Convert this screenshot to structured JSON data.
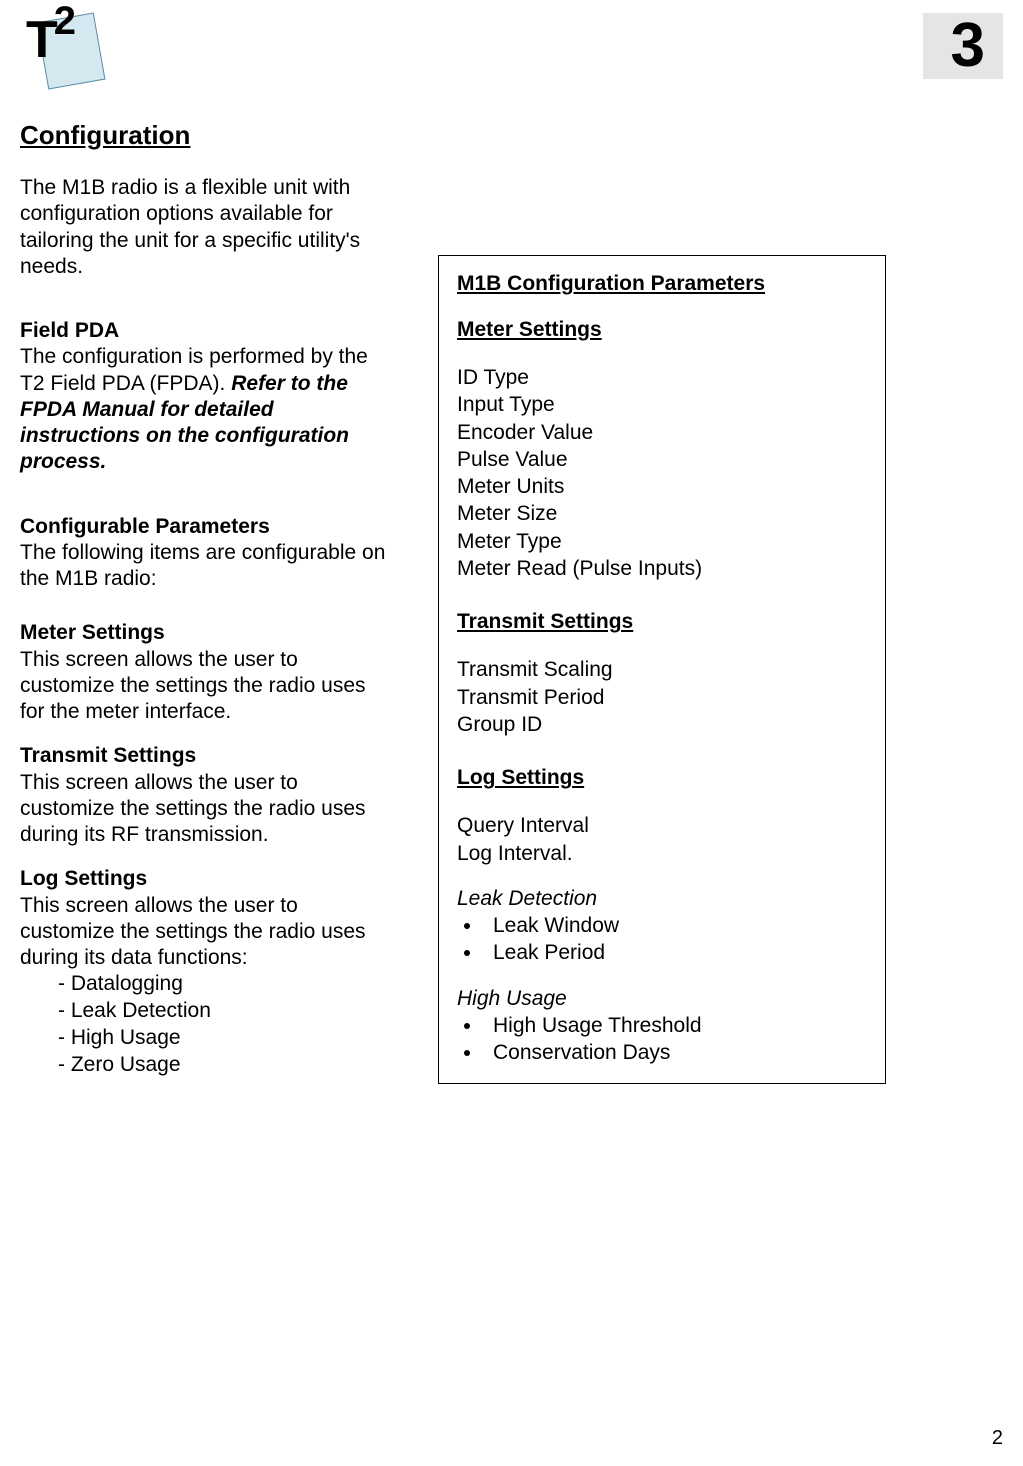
{
  "header": {
    "logo_t": "T",
    "logo_2": "2",
    "chapter_number": "3"
  },
  "main_heading": "Configuration",
  "intro": "The M1B radio is a flexible unit with configuration options available for tailoring the unit for a specific utility's needs.",
  "sections": {
    "field_pda": {
      "heading": "Field PDA",
      "text_pre": "The configuration is performed by the T2 Field PDA (FPDA).  ",
      "text_emph": "Refer to the FPDA Manual for detailed instructions on the configuration process."
    },
    "config_params": {
      "heading": "Configurable Parameters",
      "text": "The following items are configurable on the M1B radio:"
    },
    "meter_settings": {
      "heading": "Meter Settings",
      "text": "This screen allows the user to customize the settings the radio uses for the meter interface."
    },
    "transmit_settings": {
      "heading": "Transmit Settings",
      "text": "This screen allows the user to customize the settings the radio uses during its RF transmission."
    },
    "log_settings": {
      "heading": "Log Settings",
      "text": "This screen allows the user to customize the settings the radio uses during its data functions:",
      "items": [
        "- Datalogging",
        "- Leak Detection",
        "- High Usage",
        "- Zero Usage"
      ]
    }
  },
  "box": {
    "title": "M1B Configuration Parameters",
    "meter": {
      "heading": "Meter Settings",
      "items": [
        "ID Type",
        "Input Type",
        "Encoder Value",
        "Pulse Value",
        "Meter Units",
        "Meter Size",
        "Meter Type",
        "Meter Read (Pulse Inputs)"
      ]
    },
    "transmit": {
      "heading": "Transmit Settings",
      "items": [
        "Transmit Scaling",
        "Transmit Period",
        "Group ID"
      ]
    },
    "log": {
      "heading": "Log Settings",
      "items": [
        "Query Interval",
        "Log Interval."
      ],
      "leak": {
        "label": "Leak Detection",
        "bullets": [
          "Leak Window",
          "Leak Period"
        ]
      },
      "high_usage": {
        "label": "High Usage",
        "bullets": [
          "High Usage Threshold",
          "Conservation Days"
        ]
      }
    }
  },
  "page_number": "2"
}
